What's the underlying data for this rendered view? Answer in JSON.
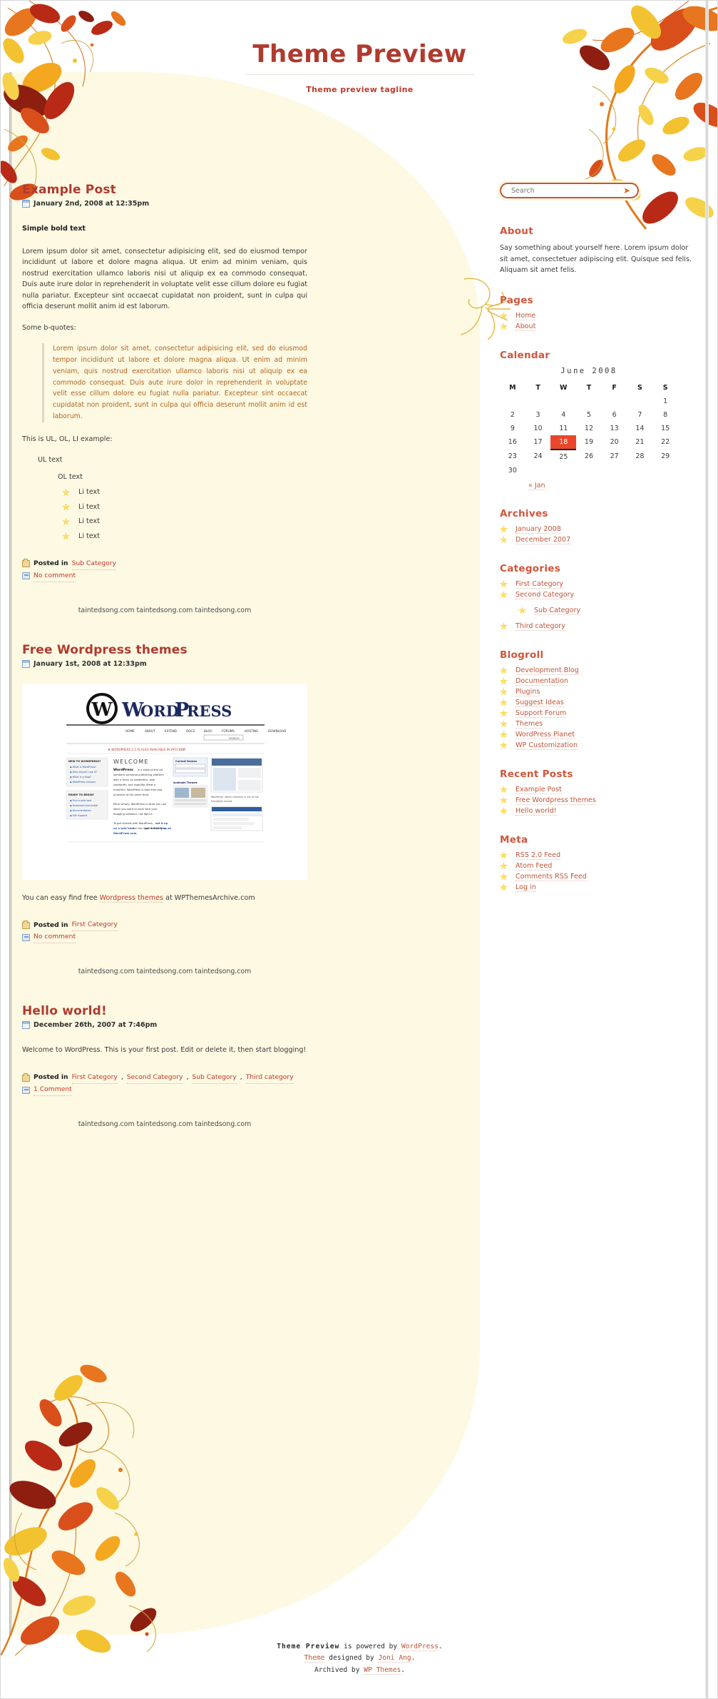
{
  "header": {
    "title": "Theme Preview",
    "tagline": "Theme preview tagline"
  },
  "colors": {
    "accent": "#b03a2e",
    "heading": "#d0553a",
    "link": "#c0563a",
    "quote": "#b2651f",
    "page_bg": "#ffffff",
    "content_bg": "#fdf9e3",
    "today_bg": "#e8472b"
  },
  "posts": [
    {
      "title": "Example Post",
      "date": "January 2nd, 2008 at 12:35pm",
      "bold_line": "Simple bold text",
      "paragraph": "Lorem ipsum dolor sit amet, consectetur adipisicing elit, sed do eiusmod tempor incididunt ut labore et dolore magna aliqua. Ut enim ad minim veniam, quis nostrud exercitation ullamco laboris nisi ut aliquip ex ea commodo consequat. Duis aute irure dolor in reprehenderit in voluptate velit esse cillum dolore eu fugiat nulla pariatur. Excepteur sint occaecat cupidatat non proident, sunt in culpa qui officia deserunt mollit anim id est laborum.",
      "quotes_label": "Some b-quotes:",
      "blockquote": "Lorem ipsum dolor sit amet, consectetur adipisicing elit, sed do eiusmod tempor incididunt ut labore et dolore magna aliqua. Ut enim ad minim veniam, quis nostrud exercitation ullamco laboris nisi ut aliquip ex ea commodo consequat. Duis aute irure dolor in reprehenderit in voluptate velit esse cillum dolore eu fugiat nulla pariatur. Excepteur sint occaecat cupidatat non proident, sunt in culpa qui officia deserunt mollit anim id est laborum.",
      "list_label": "This is UL, OL, LI example:",
      "ul_text": "UL text",
      "ol_text": "OL text",
      "li_items": [
        "Li text",
        "Li text",
        "Li text",
        "Li text"
      ],
      "posted_in_label": "Posted in",
      "categories": [
        "Sub Category"
      ],
      "comments": "No comment"
    },
    {
      "title": "Free Wordpress themes",
      "date": "January 1st, 2008 at 12:33pm",
      "caption_before": "You can easy find free ",
      "caption_link": "Wordpress themes",
      "caption_after": " at WPThemesArchive.com",
      "posted_in_label": "Posted in",
      "categories": [
        "First Category"
      ],
      "comments": "No comment",
      "screenshot": {
        "logo_text": "WordPress",
        "nav": [
          "HOME",
          "ABOUT",
          "EXTEND",
          "DOCS",
          "BLOG",
          "FORUMS",
          "HOSTING",
          "DOWNLOAD"
        ],
        "banner": "WORDPRESS 2.5 IS ALSO AVAILABLE IN PYCCKMN",
        "welcome_heading": "WELCOME",
        "welcome_body": "WordPress is a state-of-the-art semantic personal publishing platform with a focus on aesthetics, web standards, and usability. What a mouthful. WordPress is both free and priceless at the same time.",
        "welcome_body2": "More simply, WordPress is what you use when you want to work with your blogging software, not fight it.",
        "welcome_body3": "To get started with WordPress, set it up on a web host for the most flexibility or get a free blog on WordPress.com.",
        "side_box_title": "Current Version",
        "side_box2_title": "Available Themes",
        "side_caption": "WordPress' admin interface is one of the friendliest around.",
        "left_col_title": "NEW TO WORDPRESS?",
        "left_col_items": [
          "What is WordPress?",
          "Who should I use it?",
          "What is a blog?",
          "WordPress Lessons"
        ],
        "left_col2_title": "READY TO BEGIN?",
        "left_col2_items": [
          "Find a web host",
          "Download and Install",
          "Documentation",
          "Get Support"
        ],
        "search_label": "SEARCH"
      }
    },
    {
      "title": "Hello world!",
      "date": "December 26th, 2007 at 7:46pm",
      "paragraph": "Welcome to WordPress. This is your first post. Edit or delete it, then start blogging!",
      "posted_in_label": "Posted in",
      "categories": [
        "First Category",
        "Second Category",
        "Sub Category",
        "Third category"
      ],
      "comments": "1 Comment"
    }
  ],
  "watermark": "taintedsong.com taintedsong.com taintedsong.com",
  "sidebar": {
    "search": {
      "value": "Search",
      "placeholder": "Search",
      "button_icon": "arrow-right-icon"
    },
    "about": {
      "heading": "About",
      "text": "Say something about yourself here. Lorem ipsum dolor sit amet, consectetuer adipiscing elit. Quisque sed felis. Aliquam sit amet felis."
    },
    "pages": {
      "heading": "Pages",
      "items": [
        "Home",
        "About"
      ]
    },
    "calendar": {
      "heading": "Calendar",
      "caption": "June 2008",
      "weekdays": [
        "M",
        "T",
        "W",
        "T",
        "F",
        "S",
        "S"
      ],
      "weeks": [
        [
          "",
          "",
          "",
          "",
          "",
          "",
          "1"
        ],
        [
          "2",
          "3",
          "4",
          "5",
          "6",
          "7",
          "8"
        ],
        [
          "9",
          "10",
          "11",
          "12",
          "13",
          "14",
          "15"
        ],
        [
          "16",
          "17",
          "18",
          "19",
          "20",
          "21",
          "22"
        ],
        [
          "23",
          "24",
          "25",
          "26",
          "27",
          "28",
          "29"
        ],
        [
          "30",
          "",
          "",
          "",
          "",
          "",
          ""
        ]
      ],
      "today": "18",
      "prev_link": "« Jan"
    },
    "archives": {
      "heading": "Archives",
      "items": [
        "January 2008",
        "December 2007"
      ]
    },
    "categories": {
      "heading": "Categories",
      "items": [
        {
          "label": "First Category",
          "indent": false
        },
        {
          "label": "Second Category",
          "indent": false
        },
        {
          "label": "Sub Category",
          "indent": true
        },
        {
          "label": "Third category",
          "indent": false
        }
      ]
    },
    "blogroll": {
      "heading": "Blogroll",
      "items": [
        "Development Blog",
        "Documentation",
        "Plugins",
        "Suggest Ideas",
        "Support Forum",
        "Themes",
        "WordPress Planet",
        "WP Customization"
      ]
    },
    "recent_posts": {
      "heading": "Recent Posts",
      "items": [
        "Example Post",
        "Free Wordpress themes",
        "Hello world!"
      ]
    },
    "meta": {
      "heading": "Meta",
      "items": [
        "RSS 2.0 Feed",
        "Atom Feed",
        "Comments RSS Feed",
        "Log in"
      ]
    }
  },
  "footer": {
    "line1_name": "Theme Preview",
    "line1_mid": " is powered by ",
    "line1_link": "WordPress",
    "line1_end": ".",
    "line2_link": "Theme",
    "line2_mid": " designed by ",
    "line2_link2": "Joni Ang",
    "line2_end": ".",
    "line3_start": "Archived by ",
    "line3_link": "WP Themes",
    "line3_end": "."
  }
}
